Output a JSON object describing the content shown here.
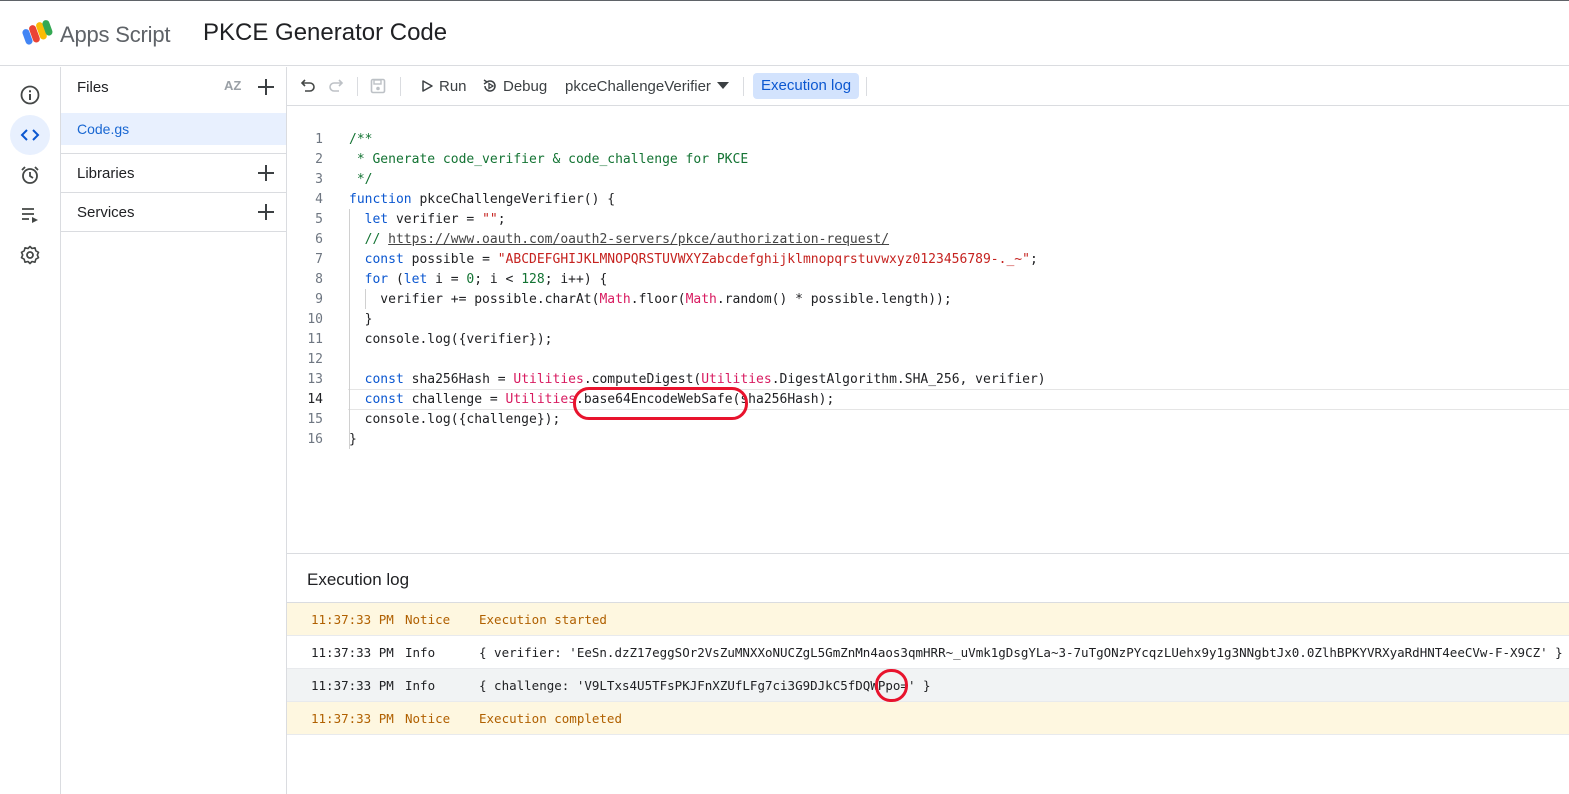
{
  "header": {
    "app_name": "Apps Script",
    "project_title": "PKCE Generator Code",
    "logo_icon": "apps-script-logo"
  },
  "rail": {
    "items": [
      {
        "name": "overview",
        "icon": "info-icon"
      },
      {
        "name": "editor",
        "icon": "code-icon",
        "active": true
      },
      {
        "name": "triggers",
        "icon": "alarm-clock-icon"
      },
      {
        "name": "executions",
        "icon": "executions-list-icon"
      },
      {
        "name": "settings",
        "icon": "gear-icon"
      }
    ]
  },
  "files_panel": {
    "files_label": "Files",
    "sort_label": "AZ",
    "file_name": "Code.gs",
    "libraries_label": "Libraries",
    "services_label": "Services"
  },
  "toolbar": {
    "run_label": "Run",
    "debug_label": "Debug",
    "function_select": "pkceChallengeVerifier",
    "execution_log_label": "Execution log"
  },
  "editor": {
    "lines": [
      {
        "n": "1",
        "text": "/**"
      },
      {
        "n": "2",
        "text": " * Generate code_verifier & code_challenge for PKCE"
      },
      {
        "n": "3",
        "text": " */"
      },
      {
        "n": "4",
        "text": "function pkceChallengeVerifier() {"
      },
      {
        "n": "5",
        "text": "  let verifier = \"\";"
      },
      {
        "n": "6",
        "text": "  // https://www.oauth.com/oauth2-servers/pkce/authorization-request/"
      },
      {
        "n": "7",
        "text": "  const possible = \"ABCDEFGHIJKLMNOPQRSTUVWXYZabcdefghijklmnopqrstuvwxyz0123456789-._~\";"
      },
      {
        "n": "8",
        "text": "  for (let i = 0; i < 128; i++) {"
      },
      {
        "n": "9",
        "text": "    verifier += possible.charAt(Math.floor(Math.random() * possible.length));"
      },
      {
        "n": "10",
        "text": "  }"
      },
      {
        "n": "11",
        "text": "  console.log({verifier});"
      },
      {
        "n": "12",
        "text": ""
      },
      {
        "n": "13",
        "text": "  const sha256Hash = Utilities.computeDigest(Utilities.DigestAlgorithm.SHA_256, verifier)"
      },
      {
        "n": "14",
        "text": "  const challenge = Utilities.base64EncodeWebSafe(sha256Hash);"
      },
      {
        "n": "15",
        "text": "  console.log({challenge});"
      },
      {
        "n": "16",
        "text": "}"
      }
    ]
  },
  "log": {
    "title": "Execution log",
    "rows": [
      {
        "time": "11:37:33 PM",
        "level": "Notice",
        "message": "Execution started"
      },
      {
        "time": "11:37:33 PM",
        "level": "Info",
        "message": "{ verifier: 'EeSn.dzZ17eggSOr2VsZuMNXXoNUCZgL5GmZnMn4aos3qmHRR~_uVmk1gDsgYLa~3-7uTgONzPYcqzLUehx9y1g3NNgbtJx0.0ZlhBPKYVRXyaRdHNT4eeCVw-F-X9CZ' }"
      },
      {
        "time": "11:37:33 PM",
        "level": "Info",
        "message": "{ challenge: 'V9LTxs4U5TFsPKJFnXZUfLFg7ci3G9DJkC5fDQWPpo=' }"
      },
      {
        "time": "11:37:33 PM",
        "level": "Notice",
        "message": "Execution completed"
      }
    ]
  },
  "colors": {
    "accent": "#1a73e8",
    "notice_bg": "#fef7e0",
    "annotation": "#e8132d"
  }
}
